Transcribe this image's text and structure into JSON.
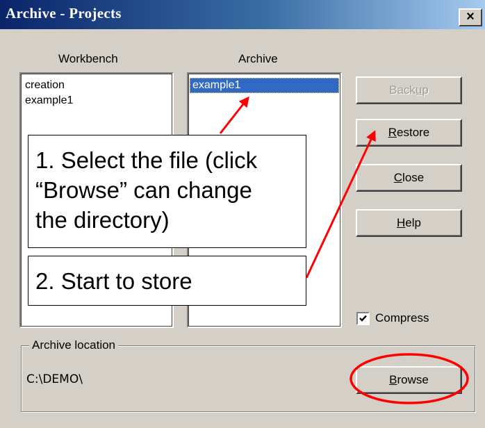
{
  "window": {
    "title": "Archive - Projects",
    "close_glyph": "×",
    "close_icon": "close-icon"
  },
  "workbench": {
    "label": "Workbench",
    "items": [
      "creation",
      "example1"
    ]
  },
  "archive": {
    "label": "Archive",
    "items": [
      "example1"
    ],
    "selected": "example1"
  },
  "buttons": {
    "backup": {
      "pre": "Back",
      "key": "u",
      "post": "p",
      "disabled": true
    },
    "restore": {
      "pre": "",
      "key": "R",
      "post": "estore"
    },
    "close": {
      "pre": "",
      "key": "C",
      "post": "lose"
    },
    "help": {
      "pre": "",
      "key": "H",
      "post": "elp"
    },
    "browse": {
      "pre": "",
      "key": "B",
      "post": "rowse"
    }
  },
  "compress": {
    "label": "Compress",
    "checked": true
  },
  "location": {
    "group_label": "Archive location",
    "path": "C:\\DEMO\\"
  },
  "annotations": {
    "step1": [
      "1. Select the file (click",
      "“Browse” can change",
      "the directory)"
    ],
    "step2": "2. Start to store",
    "color": "#ff0000"
  }
}
